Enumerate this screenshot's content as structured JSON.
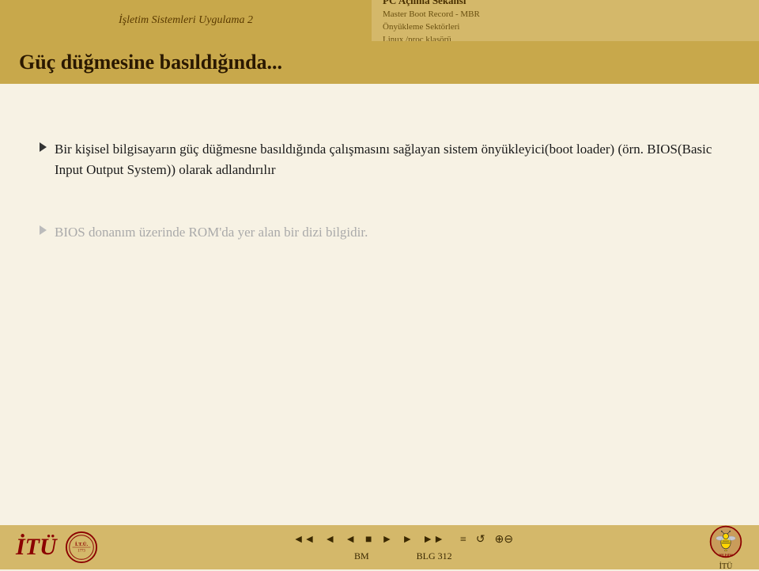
{
  "header": {
    "left_title": "İşletim Sistemleri Uygulama 2",
    "right_top": "PC Açılma Sekansı",
    "right_sub1": "Master Boot Record - MBR",
    "right_sub2": "Önyükleme Sektörleri",
    "right_sub3": "Linux /proc klasörü"
  },
  "slide": {
    "title": "Güç düğmesine basıldığında...",
    "bullet1": "Bir kişisel bilgisayarın güç düğmesne basıldığında çalışmasını sağlayan sistem önyükleyici(boot loader) (örn. BIOS(Basic Input Output System)) olarak adlandırılır",
    "bullet2": "BIOS donanım üzerinde ROM'da yer alan bir dizi bilgidir."
  },
  "footer": {
    "itu_left": "İTÜ",
    "bm_label": "BM",
    "blg_label": "BLG 312",
    "itu_right": "İTÜ",
    "nav_buttons": [
      "◄",
      "◄",
      "◄",
      "►",
      "►",
      "►",
      "═",
      "↺",
      "🔍"
    ]
  }
}
